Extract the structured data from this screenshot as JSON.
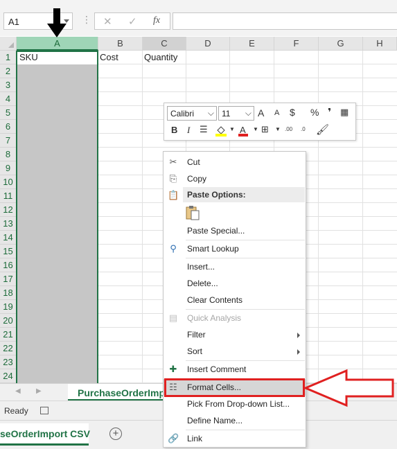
{
  "formula_bar": {
    "name_box": "A1",
    "dots": "⋮",
    "cancel": "✕",
    "enter": "✓",
    "fx": "fx",
    "formula": ""
  },
  "grid": {
    "columns": [
      "A",
      "B",
      "C",
      "D",
      "E",
      "F",
      "G",
      "H"
    ],
    "rows": [
      "1",
      "2",
      "3",
      "4",
      "5",
      "6",
      "7",
      "8",
      "9",
      "10",
      "11",
      "12",
      "13",
      "14",
      "15",
      "16",
      "17",
      "18",
      "19",
      "20",
      "21",
      "22",
      "23",
      "24"
    ],
    "cells": {
      "A1": "SKU",
      "B1": "Cost",
      "C1": "Quantity"
    }
  },
  "sheet_tabs": {
    "nav_prev": "◀",
    "nav_next": "▶",
    "active": "PurchaseOrderImpor"
  },
  "status_bar": {
    "text": "Ready"
  },
  "bottom_bar": {
    "tab": "seOrderImport CSV",
    "add": "+"
  },
  "mini_toolbar": {
    "font": "Calibri",
    "size": "11",
    "grow": "A",
    "shrink": "A",
    "currency": "$",
    "percent": "%",
    "comma": "❜",
    "bold": "B",
    "italic": "I",
    "increase_decimal": ".00",
    "decrease_decimal": ".0"
  },
  "context_menu": {
    "items": [
      {
        "label": "Cut",
        "icon": "scissors-icon"
      },
      {
        "label": "Copy",
        "icon": "copy-icon"
      },
      {
        "label": "Paste Options:",
        "icon": "paste-icon"
      },
      {
        "label": "Paste Special...",
        "icon": ""
      },
      {
        "label": "Smart Lookup",
        "icon": "smart-lookup-icon"
      },
      {
        "label": "Insert...",
        "icon": ""
      },
      {
        "label": "Delete...",
        "icon": ""
      },
      {
        "label": "Clear Contents",
        "icon": ""
      },
      {
        "label": "Quick Analysis",
        "icon": "quick-analysis-icon"
      },
      {
        "label": "Filter",
        "icon": ""
      },
      {
        "label": "Sort",
        "icon": ""
      },
      {
        "label": "Insert Comment",
        "icon": "insert-comment-icon"
      },
      {
        "label": "Format Cells...",
        "icon": "format-cells-icon"
      },
      {
        "label": "Pick From Drop-down List...",
        "icon": ""
      },
      {
        "label": "Define Name...",
        "icon": ""
      },
      {
        "label": "Link",
        "icon": "link-icon"
      }
    ]
  },
  "colors": {
    "excel_green": "#217346",
    "selected_header": "#9fd5b7",
    "annotation_red": "#e02020"
  }
}
